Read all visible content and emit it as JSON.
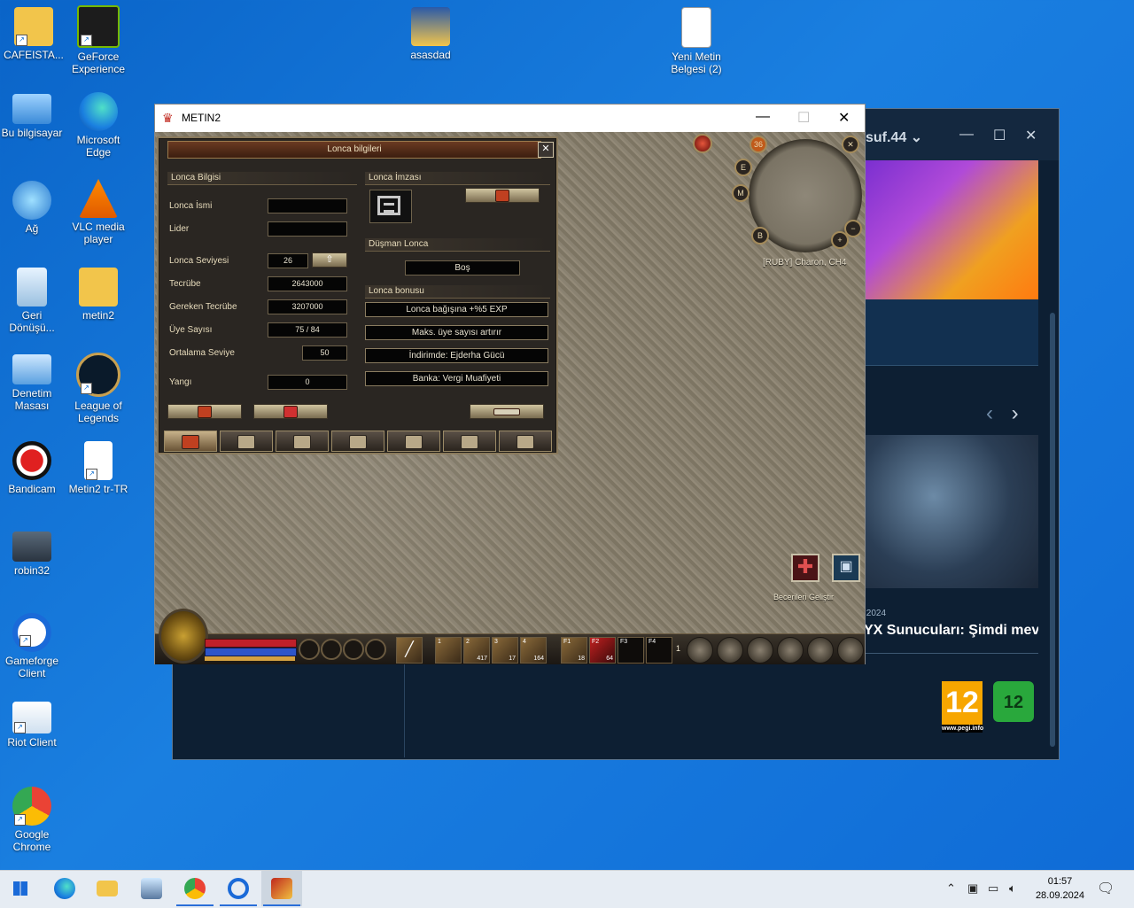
{
  "desktop_icons": [
    {
      "label": "CAFEISTA...",
      "icon": "folder-user-icon"
    },
    {
      "label": "GeForce Experience",
      "icon": "nvidia-icon"
    },
    {
      "label": "asasdad",
      "icon": "folder-icon"
    },
    {
      "label": "Yeni Metin Belgesi (2)",
      "icon": "text-document-icon"
    },
    {
      "label": "Bu bilgisayar",
      "icon": "computer-icon"
    },
    {
      "label": "Microsoft Edge",
      "icon": "edge-icon"
    },
    {
      "label": "Ağ",
      "icon": "network-icon"
    },
    {
      "label": "VLC media player",
      "icon": "vlc-icon"
    },
    {
      "label": "Geri Dönüşü...",
      "icon": "recycle-bin-icon"
    },
    {
      "label": "metin2",
      "icon": "folder-icon"
    },
    {
      "label": "Denetim Masası",
      "icon": "control-panel-icon"
    },
    {
      "label": "League of Legends",
      "icon": "league-icon"
    },
    {
      "label": "Bandicam",
      "icon": "bandicam-icon"
    },
    {
      "label": "Metin2 tr-TR",
      "icon": "document-icon"
    },
    {
      "label": "robin32",
      "icon": "image-file-icon"
    },
    {
      "label": "Gameforge Client",
      "icon": "gameforge-icon"
    },
    {
      "label": "Riot Client",
      "icon": "riot-icon"
    },
    {
      "label": "Google Chrome",
      "icon": "chrome-icon"
    }
  ],
  "gameforge": {
    "user": "suf.44",
    "news_headline": "YX Sunucuları: Şimdi mevc",
    "news_date": ".2024",
    "pegi_label": "12",
    "pegi_site": "www.pegi.info",
    "usk_label": "12"
  },
  "metin2_window": {
    "title": "METIN2",
    "minimize": "—",
    "maximize": "☐",
    "close": "✕"
  },
  "minimap": {
    "server": "[RUBY] Charon, CH4",
    "level_badge": "36",
    "buttons": [
      "E",
      "M",
      "B",
      "+",
      "−"
    ]
  },
  "guild": {
    "title": "Lonca bilgileri",
    "close": "✕",
    "sections": {
      "info": "Lonca Bilgisi",
      "signature": "Lonca İmzası",
      "enemy": "Düşman Lonca",
      "bonus": "Lonca bonusu"
    },
    "fields": {
      "name_label": "Lonca İsmi",
      "name_value": "",
      "leader_label": "Lider",
      "leader_value": "",
      "level_label": "Lonca Seviyesi",
      "level_value": "26",
      "exp_label": "Tecrübe",
      "exp_value": "2643000",
      "req_exp_label": "Gereken Tecrübe",
      "req_exp_value": "3207000",
      "members_label": "Üye Sayısı",
      "members_value": "75 / 84",
      "avg_level_label": "Ortalama Seviye",
      "avg_level_value": "50",
      "fire_label": "Yangı",
      "fire_value": "0"
    },
    "enemy_value": "Boş",
    "bonuses": [
      "Lonca bağışına +%5 EXP",
      "Maks. üye sayısı artırır",
      "İndirimde: Ejderha Gücü",
      "Banka: Vergi Muafiyeti"
    ]
  },
  "skill_upgrade_label": "Becerileri Geliştir",
  "hud": {
    "slots": [
      {
        "key": "",
        "count": ""
      },
      {
        "key": "1",
        "count": ""
      },
      {
        "key": "2",
        "count": "417"
      },
      {
        "key": "3",
        "count": "17"
      },
      {
        "key": "4",
        "count": "164"
      },
      {
        "key": "F1",
        "count": "18"
      },
      {
        "key": "F2",
        "count": "64"
      },
      {
        "key": "F3",
        "count": ""
      },
      {
        "key": "F4",
        "count": ""
      }
    ],
    "page": "1"
  },
  "taskbar": {
    "time": "01:57",
    "date": "28.09.2024",
    "apps": [
      "start-icon",
      "edge-icon",
      "file-explorer-icon",
      "control-panel-icon",
      "chrome-icon",
      "gameforge-icon",
      "metin2-icon"
    ]
  }
}
